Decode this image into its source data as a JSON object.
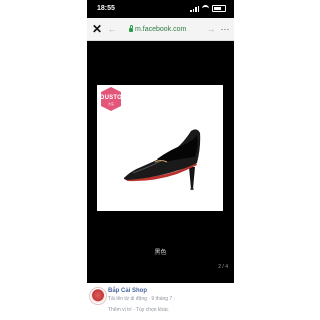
{
  "status_bar": {
    "time": "18:55"
  },
  "browser": {
    "url": "m.facebook.com",
    "close_symbol": "✕",
    "back_symbol": "←",
    "forward_symbol": "→",
    "menu_symbol": "⋯"
  },
  "photo": {
    "brand_name": "DUSTO",
    "brand_sub": "大东",
    "brand_color": "#e4557a",
    "caption": "黑色",
    "counter": "2 / 4"
  },
  "post": {
    "shop_name": "Bắp Cải Shop",
    "meta": "Tải lên từ di động · 9 tháng 7 · ",
    "links": "Thêm vị trí · Tùy chọn khác"
  },
  "colors": {
    "accent_green": "#2e7d45",
    "link_blue": "#4a66a0"
  }
}
